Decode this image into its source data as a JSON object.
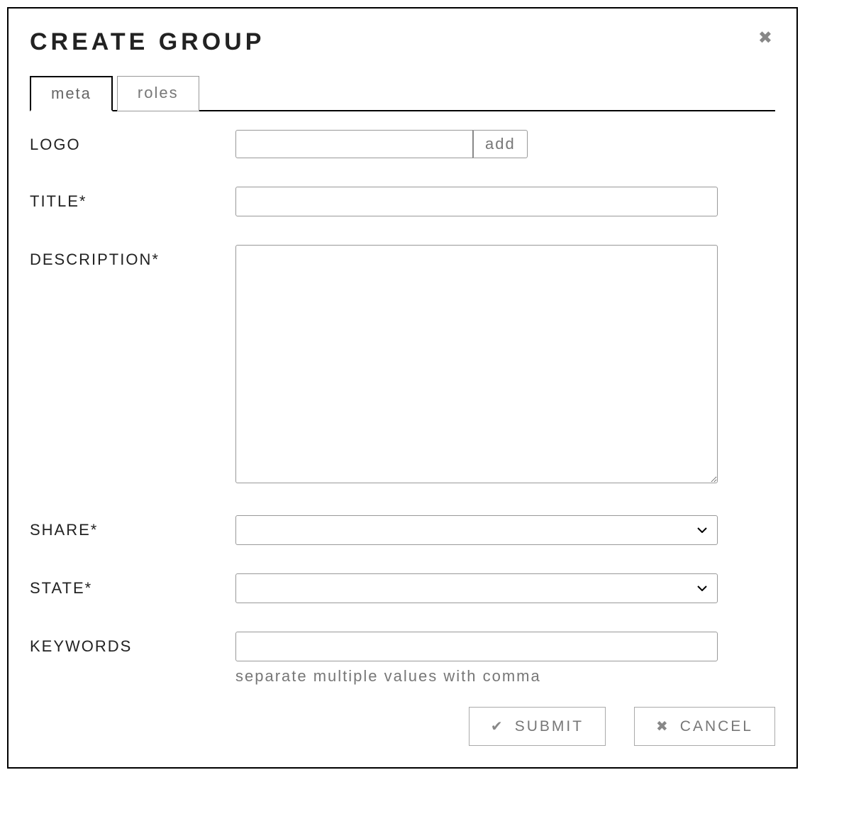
{
  "dialog": {
    "title": "CREATE GROUP"
  },
  "tabs": {
    "meta": "meta",
    "roles": "roles"
  },
  "form": {
    "logo": {
      "label": "LOGO",
      "value": "",
      "add_button": "add"
    },
    "title": {
      "label": "TITLE*",
      "value": ""
    },
    "description": {
      "label": "DESCRIPTION*",
      "value": ""
    },
    "share": {
      "label": "SHARE*",
      "value": ""
    },
    "state": {
      "label": "STATE*",
      "value": ""
    },
    "keywords": {
      "label": "KEYWORDS",
      "value": "",
      "hint": "separate multiple values with comma"
    }
  },
  "actions": {
    "submit": "SUBMIT",
    "cancel": "CANCEL"
  }
}
